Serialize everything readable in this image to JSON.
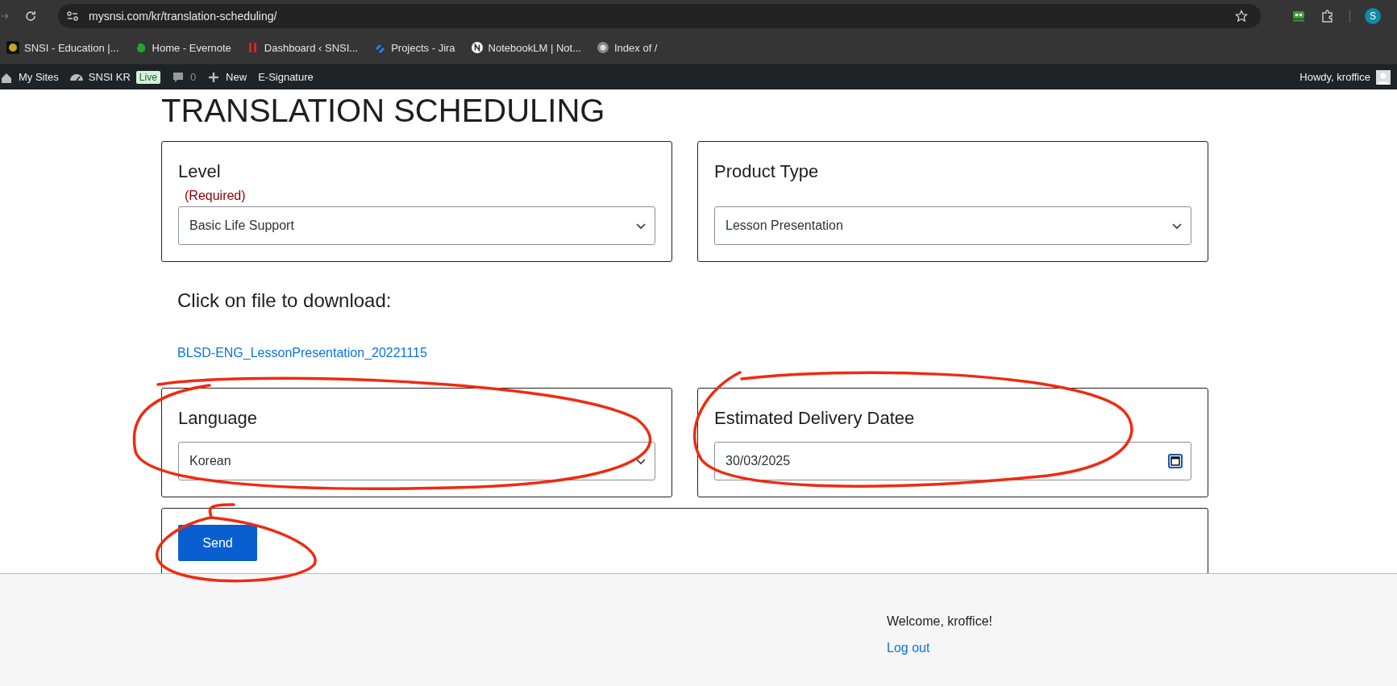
{
  "browser": {
    "url": "mysnsi.com/kr/translation-scheduling/",
    "profile_initial": "S",
    "bookmarks": [
      {
        "label": "SNSI - Education |..."
      },
      {
        "label": "Home - Evernote"
      },
      {
        "label": "Dashboard ‹ SNSI..."
      },
      {
        "label": "Projects - Jira"
      },
      {
        "label": "NotebookLM | Not..."
      },
      {
        "label": "Index of /"
      }
    ]
  },
  "admin_bar": {
    "items": [
      {
        "kind": "sites",
        "label": "My Sites"
      },
      {
        "kind": "site",
        "label": "SNSI KR",
        "badge": "Live"
      },
      {
        "kind": "comments",
        "label": "0"
      },
      {
        "kind": "new",
        "label": "New"
      },
      {
        "kind": "plain",
        "label": "E-Signature"
      }
    ],
    "greeting": "Howdy, kroffice"
  },
  "page": {
    "title": "TRANSLATION SCHEDULING",
    "top_fields": [
      {
        "kind": "select",
        "label": "Level",
        "note": "(Required)",
        "value": "Basic Life Support"
      },
      {
        "kind": "select",
        "label": "Product Type",
        "value": "Lesson Presentation"
      }
    ],
    "download": {
      "heading": "Click on file to download:",
      "files": [
        "BLSD-ENG_LessonPresentation_20221115"
      ]
    },
    "bottom_fields": [
      {
        "kind": "select",
        "label": "Language",
        "value": "Korean"
      },
      {
        "kind": "date",
        "label": "Estimated Delivery Datee",
        "value": "30/03/2025"
      }
    ],
    "submit": "Send"
  },
  "footer": {
    "welcome": "Welcome, kroffice!",
    "logout": "Log out"
  }
}
